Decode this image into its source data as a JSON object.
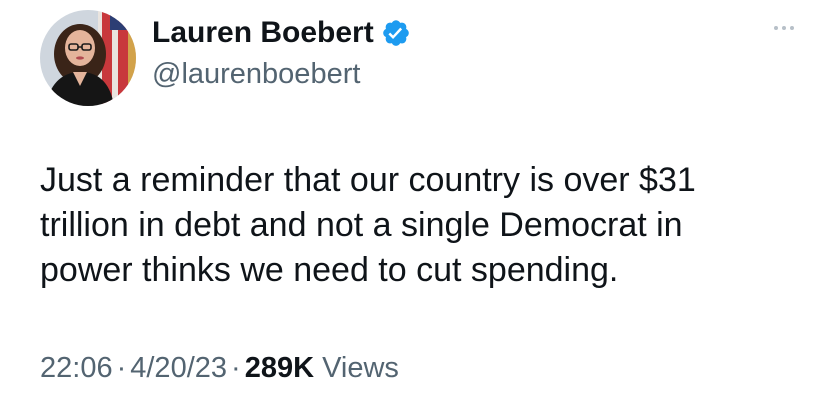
{
  "author": {
    "display_name": "Lauren Boebert",
    "handle": "@laurenboebert",
    "verified_icon": "verified-badge-icon",
    "avatar_icon": "profile-photo"
  },
  "tweet": {
    "lines": [
      "Just a reminder that our country is over $31",
      "trillion in debt and not a single Democrat in",
      "power thinks we need to cut spending."
    ]
  },
  "meta": {
    "time": "22:06",
    "separator": "·",
    "date": "4/20/23",
    "views_count": "289K",
    "views_label": "Views"
  },
  "colors": {
    "text_primary": "#0f1419",
    "text_secondary": "#536471",
    "verified_blue": "#1d9bf0"
  }
}
